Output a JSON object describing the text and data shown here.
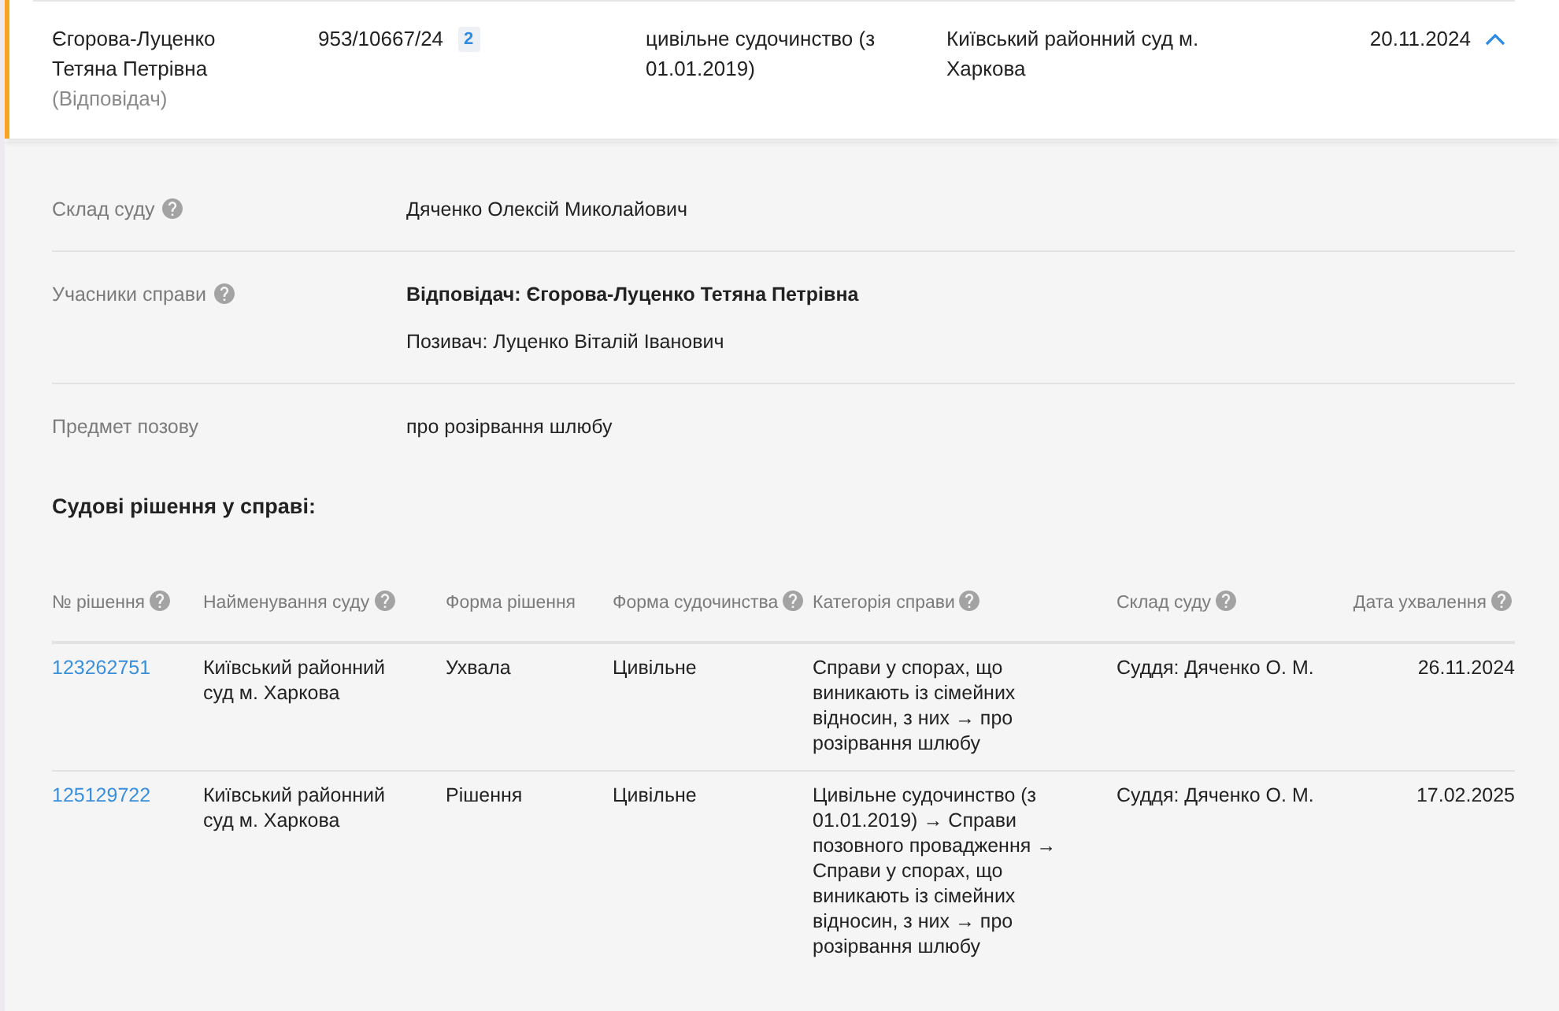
{
  "case_row": {
    "party_name": "Єгорова-Луценко Тетяна Петрівна",
    "party_role": "(Відповідач)",
    "case_number": "953/10667/24",
    "count_badge": "2",
    "proceeding": "цивільне судочинство (з 01.01.2019)",
    "court": "Київський районний суд м. Харкова",
    "date": "20.11.2024",
    "expanded": true
  },
  "details": [
    {
      "label": "Склад суду",
      "help": true,
      "values": [
        {
          "text": "Дяченко Олексій Миколайович",
          "bold": false
        }
      ]
    },
    {
      "label": "Учасники справи",
      "help": true,
      "values": [
        {
          "text": "Відповідач: Єгорова-Луценко Тетяна Петрівна",
          "bold": true
        },
        {
          "text": "Позивач: Луценко Віталій Іванович",
          "bold": false
        }
      ]
    },
    {
      "label": "Предмет позову",
      "help": false,
      "values": [
        {
          "text": "про розірвання шлюбу",
          "bold": false
        }
      ]
    }
  ],
  "decisions": {
    "title": "Судові рішення у справі:",
    "columns": [
      {
        "label": "№ рішення",
        "help": true
      },
      {
        "label": "Найменування суду",
        "help": true
      },
      {
        "label": "Форма рішення",
        "help": false
      },
      {
        "label": "Форма судочинства",
        "help": true
      },
      {
        "label": "Категорія справи",
        "help": true
      },
      {
        "label": "Склад суду",
        "help": true
      },
      {
        "label": "Дата ухвалення",
        "help": true
      }
    ],
    "rows": [
      {
        "cells": [
          "123262751",
          "Київський районний суд м. Харкова",
          "Ухвала",
          "Цивільне",
          "Справи у спорах, що виникають із сімейних відносин, з них → про розірвання шлюбу",
          "Суддя: Дяченко О. М.",
          "26.11.2024"
        ]
      },
      {
        "cells": [
          "125129722",
          "Київський районний суд м. Харкова",
          "Рішення",
          "Цивільне",
          "Цивільне судочинство (з 01.01.2019) → Справи позовного провадження → Справи у спорах, що виникають із сімейних відносин, з них → про розірвання шлюбу",
          "Суддя: Дяченко О. М.",
          "17.02.2025"
        ]
      }
    ]
  }
}
